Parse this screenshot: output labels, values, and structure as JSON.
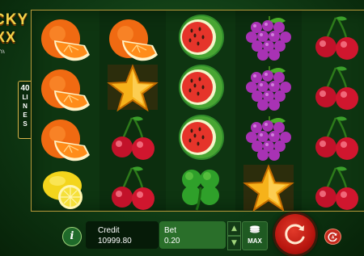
{
  "game": {
    "logo_line1": "CKY",
    "logo_line2": "XX",
    "logo_line3": "0)",
    "lines_count": "40",
    "lines_label": "LINES"
  },
  "reels": [
    [
      "orange-icon",
      "orange-icon",
      "orange-icon",
      "lemon-icon"
    ],
    [
      "orange-icon",
      "star-icon",
      "cherry-icon",
      "cherry-icon"
    ],
    [
      "watermelon-icon",
      "watermelon-icon",
      "watermelon-icon",
      "clover-icon"
    ],
    [
      "grapes-icon",
      "grapes-icon",
      "grapes-icon",
      "star-icon"
    ],
    [
      "cherry-icon",
      "cherry-icon",
      "cherry-icon",
      "cherry-icon"
    ]
  ],
  "controls": {
    "info_label": "i",
    "credit_label": "Credit",
    "credit_value": "10999.80",
    "bet_label": "Bet",
    "bet_value": "0.20",
    "bet_up": "▲",
    "bet_down": "▼",
    "max_label": "MAX"
  },
  "colors": {
    "background": "#0f3a14",
    "frame_border": "#b89a3a",
    "spin_button": "#c0180f",
    "bet_panel": "#2a6f2a"
  }
}
